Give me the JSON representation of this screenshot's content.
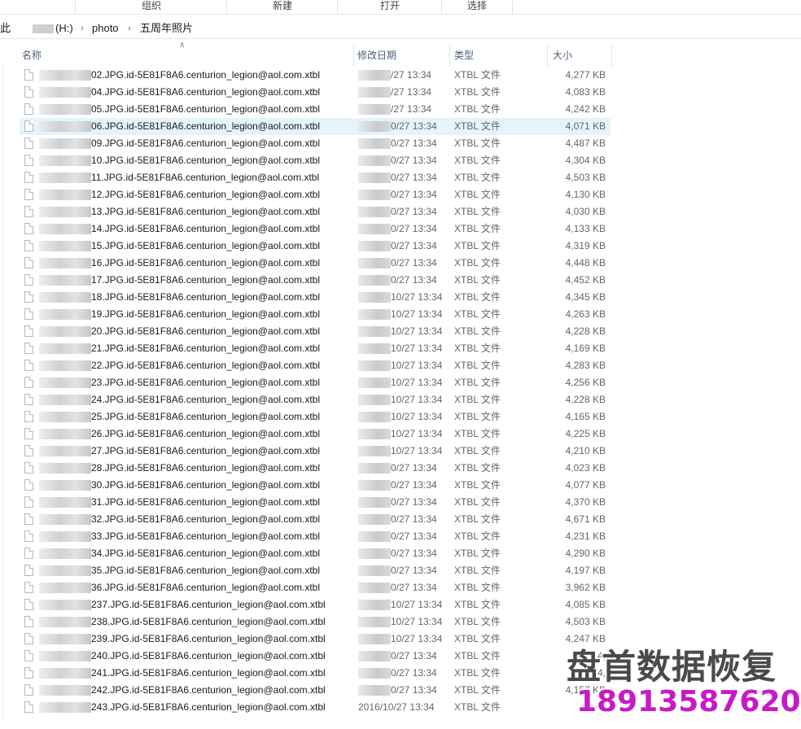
{
  "ribbon": {
    "groups": [
      "组织",
      "新建",
      "打开",
      "选择"
    ]
  },
  "breadcrumb": {
    "truncated_prefix": "此",
    "drive": "(H:)",
    "folder": "photo",
    "current": "五周年照片"
  },
  "columns": {
    "name": "名称",
    "modified": "修改日期",
    "type": "类型",
    "size": "大小"
  },
  "files": [
    {
      "name": "02.JPG.id-5E81F8A6.centurion_legion@aol.com.xtbl",
      "date": "/27 13:34",
      "type": "XTBL 文件",
      "size": "4,277 KB"
    },
    {
      "name": "04.JPG.id-5E81F8A6.centurion_legion@aol.com.xtbl",
      "date": "/27 13:34",
      "type": "XTBL 文件",
      "size": "4,083 KB"
    },
    {
      "name": "05.JPG.id-5E81F8A6.centurion_legion@aol.com.xtbl",
      "date": "/27 13:34",
      "type": "XTBL 文件",
      "size": "4,242 KB"
    },
    {
      "name": "06.JPG.id-5E81F8A6.centurion_legion@aol.com.xtbl",
      "date": "0/27 13:34",
      "type": "XTBL 文件",
      "size": "4,071 KB"
    },
    {
      "name": "09.JPG.id-5E81F8A6.centurion_legion@aol.com.xtbl",
      "date": "0/27 13:34",
      "type": "XTBL 文件",
      "size": "4,487 KB"
    },
    {
      "name": "10.JPG.id-5E81F8A6.centurion_legion@aol.com.xtbl",
      "date": "0/27 13:34",
      "type": "XTBL 文件",
      "size": "4,304 KB"
    },
    {
      "name": "11.JPG.id-5E81F8A6.centurion_legion@aol.com.xtbl",
      "date": "0/27 13:34",
      "type": "XTBL 文件",
      "size": "4,503 KB"
    },
    {
      "name": "12.JPG.id-5E81F8A6.centurion_legion@aol.com.xtbl",
      "date": "0/27 13:34",
      "type": "XTBL 文件",
      "size": "4,130 KB"
    },
    {
      "name": "13.JPG.id-5E81F8A6.centurion_legion@aol.com.xtbl",
      "date": "0/27 13:34",
      "type": "XTBL 文件",
      "size": "4,030 KB"
    },
    {
      "name": "14.JPG.id-5E81F8A6.centurion_legion@aol.com.xtbl",
      "date": "0/27 13:34",
      "type": "XTBL 文件",
      "size": "4,133 KB"
    },
    {
      "name": "15.JPG.id-5E81F8A6.centurion_legion@aol.com.xtbl",
      "date": "0/27 13:34",
      "type": "XTBL 文件",
      "size": "4,319 KB"
    },
    {
      "name": "16.JPG.id-5E81F8A6.centurion_legion@aol.com.xtbl",
      "date": "0/27 13:34",
      "type": "XTBL 文件",
      "size": "4,448 KB"
    },
    {
      "name": "17.JPG.id-5E81F8A6.centurion_legion@aol.com.xtbl",
      "date": "0/27 13:34",
      "type": "XTBL 文件",
      "size": "4,452 KB"
    },
    {
      "name": "18.JPG.id-5E81F8A6.centurion_legion@aol.com.xtbl",
      "date": "10/27 13:34",
      "type": "XTBL 文件",
      "size": "4,345 KB"
    },
    {
      "name": "19.JPG.id-5E81F8A6.centurion_legion@aol.com.xtbl",
      "date": "10/27 13:34",
      "type": "XTBL 文件",
      "size": "4,263 KB"
    },
    {
      "name": "20.JPG.id-5E81F8A6.centurion_legion@aol.com.xtbl",
      "date": "10/27 13:34",
      "type": "XTBL 文件",
      "size": "4,228 KB"
    },
    {
      "name": "21.JPG.id-5E81F8A6.centurion_legion@aol.com.xtbl",
      "date": "10/27 13:34",
      "type": "XTBL 文件",
      "size": "4,169 KB"
    },
    {
      "name": "22.JPG.id-5E81F8A6.centurion_legion@aol.com.xtbl",
      "date": "10/27 13:34",
      "type": "XTBL 文件",
      "size": "4,283 KB"
    },
    {
      "name": "23.JPG.id-5E81F8A6.centurion_legion@aol.com.xtbl",
      "date": "10/27 13:34",
      "type": "XTBL 文件",
      "size": "4,256 KB"
    },
    {
      "name": "24.JPG.id-5E81F8A6.centurion_legion@aol.com.xtbl",
      "date": "10/27 13:34",
      "type": "XTBL 文件",
      "size": "4,228 KB"
    },
    {
      "name": "25.JPG.id-5E81F8A6.centurion_legion@aol.com.xtbl",
      "date": "10/27 13:34",
      "type": "XTBL 文件",
      "size": "4,165 KB"
    },
    {
      "name": "26.JPG.id-5E81F8A6.centurion_legion@aol.com.xtbl",
      "date": "10/27 13:34",
      "type": "XTBL 文件",
      "size": "4,225 KB"
    },
    {
      "name": "27.JPG.id-5E81F8A6.centurion_legion@aol.com.xtbl",
      "date": "10/27 13:34",
      "type": "XTBL 文件",
      "size": "4,210 KB"
    },
    {
      "name": "28.JPG.id-5E81F8A6.centurion_legion@aol.com.xtbl",
      "date": "0/27 13:34",
      "type": "XTBL 文件",
      "size": "4,023 KB"
    },
    {
      "name": "30.JPG.id-5E81F8A6.centurion_legion@aol.com.xtbl",
      "date": "0/27 13:34",
      "type": "XTBL 文件",
      "size": "4,077 KB"
    },
    {
      "name": "31.JPG.id-5E81F8A6.centurion_legion@aol.com.xtbl",
      "date": "0/27 13:34",
      "type": "XTBL 文件",
      "size": "4,370 KB"
    },
    {
      "name": "32.JPG.id-5E81F8A6.centurion_legion@aol.com.xtbl",
      "date": "0/27 13:34",
      "type": "XTBL 文件",
      "size": "4,671 KB"
    },
    {
      "name": "33.JPG.id-5E81F8A6.centurion_legion@aol.com.xtbl",
      "date": "0/27 13:34",
      "type": "XTBL 文件",
      "size": "4,231 KB"
    },
    {
      "name": "34.JPG.id-5E81F8A6.centurion_legion@aol.com.xtbl",
      "date": "0/27 13:34",
      "type": "XTBL 文件",
      "size": "4,290 KB"
    },
    {
      "name": "35.JPG.id-5E81F8A6.centurion_legion@aol.com.xtbl",
      "date": "0/27 13:34",
      "type": "XTBL 文件",
      "size": "4,197 KB"
    },
    {
      "name": "36.JPG.id-5E81F8A6.centurion_legion@aol.com.xtbl",
      "date": "0/27 13:34",
      "type": "XTBL 文件",
      "size": "3,962 KB"
    },
    {
      "name": "237.JPG.id-5E81F8A6.centurion_legion@aol.com.xtbl",
      "date": "10/27 13:34",
      "type": "XTBL 文件",
      "size": "4,085 KB"
    },
    {
      "name": "238.JPG.id-5E81F8A6.centurion_legion@aol.com.xtbl",
      "date": "10/27 13:34",
      "type": "XTBL 文件",
      "size": "4,503 KB"
    },
    {
      "name": "239.JPG.id-5E81F8A6.centurion_legion@aol.com.xtbl",
      "date": "10/27 13:34",
      "type": "XTBL 文件",
      "size": "4,247 KB"
    },
    {
      "name": "240.JPG.id-5E81F8A6.centurion_legion@aol.com.xtbl",
      "date": "0/27 13:34",
      "type": "XTBL 文件",
      "size": "4,"
    },
    {
      "name": "241.JPG.id-5E81F8A6.centurion_legion@aol.com.xtbl",
      "date": "0/27 13:34",
      "type": "XTBL 文件",
      "size": "4,"
    },
    {
      "name": "242.JPG.id-5E81F8A6.centurion_legion@aol.com.xtbl",
      "date": "0/27 13:34",
      "type": "XTBL 文件",
      "size": "4,157 KB"
    },
    {
      "name": "243.JPG.id-5E81F8A6.centurion_legion@aol.com.xtbl",
      "date": "2016/10/27 13:34",
      "type": "XTBL 文件",
      "size": "4,40"
    }
  ],
  "selected_index": 3,
  "watermark": {
    "line1": "盘首数据恢复",
    "line2": "18913587620",
    "line2_color": "#c819c8"
  }
}
